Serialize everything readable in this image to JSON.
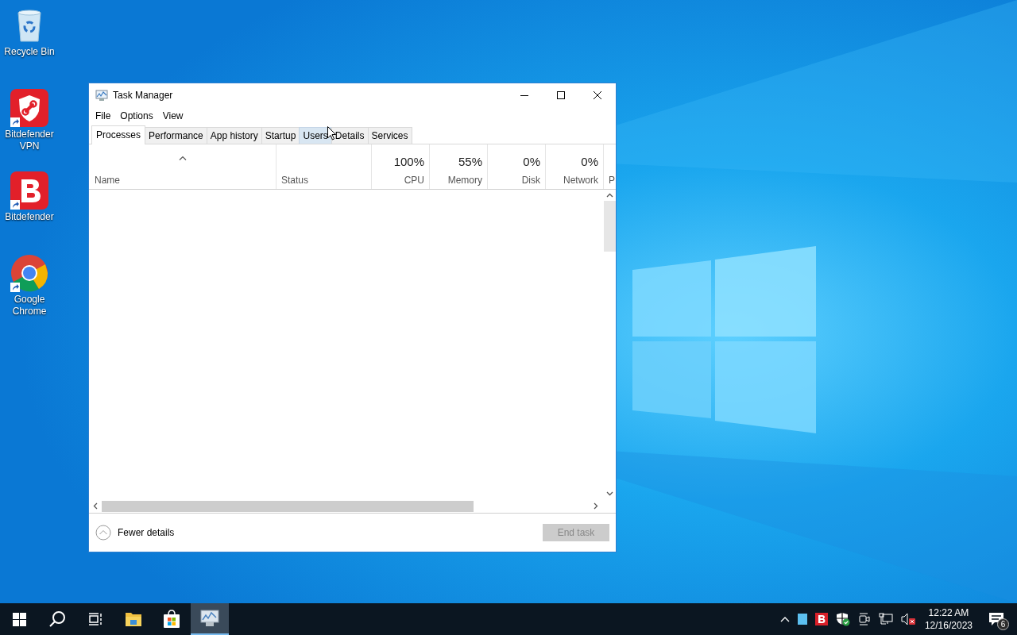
{
  "desktop_icons": [
    {
      "kind": "recycle",
      "label": "Recycle Bin",
      "shortcut": false
    },
    {
      "kind": "vpn",
      "label": "Bitdefender VPN",
      "shortcut": true
    },
    {
      "kind": "bitdefender",
      "label": "Bitdefender",
      "shortcut": true
    },
    {
      "kind": "chrome",
      "label": "Google Chrome",
      "shortcut": true
    }
  ],
  "window": {
    "title": "Task Manager",
    "menu": [
      "File",
      "Options",
      "View"
    ],
    "tabs": [
      {
        "label": "Processes",
        "selected": true,
        "hovered": false
      },
      {
        "label": "Performance",
        "selected": false,
        "hovered": false
      },
      {
        "label": "App history",
        "selected": false,
        "hovered": false
      },
      {
        "label": "Startup",
        "selected": false,
        "hovered": false
      },
      {
        "label": "Users",
        "selected": false,
        "hovered": true
      },
      {
        "label": "Details",
        "selected": false,
        "hovered": false
      },
      {
        "label": "Services",
        "selected": false,
        "hovered": false
      }
    ],
    "columns": [
      {
        "name": "Name",
        "sorted": true
      },
      {
        "name": "Status",
        "sorted": false
      },
      {
        "name": "CPU",
        "usage": "100%",
        "sorted": false
      },
      {
        "name": "Memory",
        "usage": "55%",
        "sorted": false
      },
      {
        "name": "Disk",
        "usage": "0%",
        "sorted": false
      },
      {
        "name": "Network",
        "usage": "0%",
        "sorted": false
      },
      {
        "name": "P",
        "sorted": false
      }
    ],
    "fewer_details": "Fewer details",
    "end_task": {
      "label": "End task",
      "disabled": true
    }
  },
  "taskbar": {
    "apps": [
      {
        "kind": "start",
        "active": false
      },
      {
        "kind": "search",
        "active": false
      },
      {
        "kind": "taskview",
        "active": false
      },
      {
        "kind": "folder",
        "active": false
      },
      {
        "kind": "store",
        "active": false
      },
      {
        "kind": "taskmanager",
        "active": true
      }
    ],
    "tray": [
      {
        "kind": "chevron"
      },
      {
        "kind": "square"
      },
      {
        "kind": "bitdefender"
      },
      {
        "kind": "shield"
      },
      {
        "kind": "camera"
      },
      {
        "kind": "network"
      },
      {
        "kind": "speaker-muted"
      }
    ],
    "time": "12:22 AM",
    "date": "12/16/2023",
    "notifications": "6"
  }
}
